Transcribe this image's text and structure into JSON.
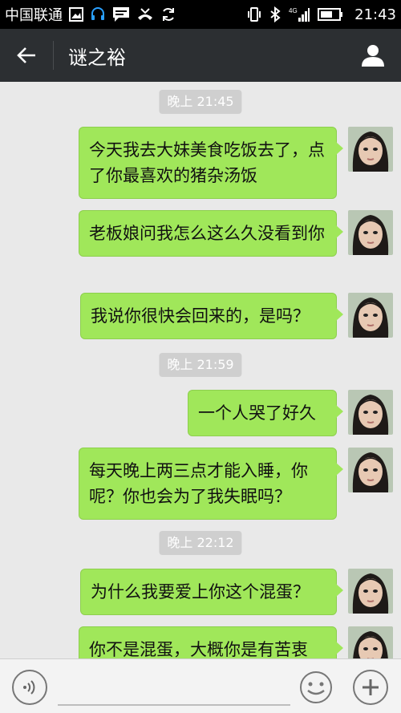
{
  "status_bar": {
    "carrier": "中国联通",
    "network": "4G",
    "time": "21:43"
  },
  "nav": {
    "title": "谜之裕"
  },
  "messages": [
    {
      "type": "time",
      "text": "晚上 21:45"
    },
    {
      "type": "sent",
      "text": "今天我去大妹美食吃饭去了，点了你最喜欢的猪杂汤饭"
    },
    {
      "type": "sent",
      "text": "老板娘问我怎么这么久没看到你"
    },
    {
      "type": "sent",
      "text": "我说你很快会回来的，是吗？"
    },
    {
      "type": "time",
      "text": "晚上 21:59"
    },
    {
      "type": "sent",
      "text": "一个人哭了好久"
    },
    {
      "type": "sent",
      "text": "每天晚上两三点才能入睡，你呢？你也会为了我失眠吗？"
    },
    {
      "type": "time",
      "text": "晚上 22:12"
    },
    {
      "type": "sent",
      "text": "为什么我要爱上你这个混蛋？"
    },
    {
      "type": "sent",
      "text": "你不是混蛋，大概你是有苦衷"
    }
  ],
  "input": {
    "placeholder": ""
  },
  "colors": {
    "bubble": "#a0e75a",
    "nav_bg": "#2c2f32",
    "chat_bg": "#e9e9e9",
    "timestamp_bg": "#cfcfcf"
  }
}
